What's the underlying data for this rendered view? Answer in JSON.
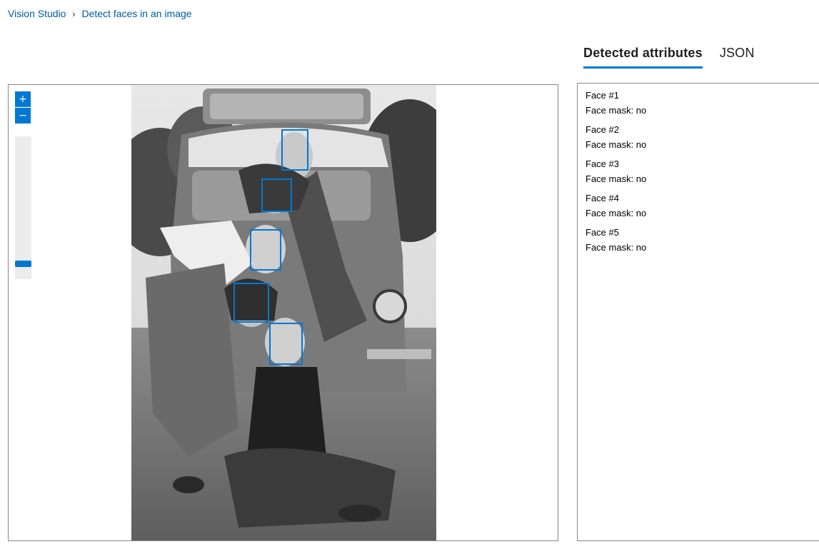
{
  "breadcrumb": {
    "root": "Vision Studio",
    "separator": "›",
    "current": "Detect faces in an image"
  },
  "viewer": {
    "zoom_in_icon": "plus-icon",
    "zoom_out_icon": "minus-icon",
    "zoom_in_label": "+",
    "zoom_out_label": "−",
    "zoom_level": 0.05
  },
  "tabs": [
    {
      "label": "Detected attributes",
      "active": true
    },
    {
      "label": "JSON",
      "active": false
    }
  ],
  "faces": [
    {
      "title": "Face #1",
      "mask": "Face mask: no"
    },
    {
      "title": "Face #2",
      "mask": "Face mask: no"
    },
    {
      "title": "Face #3",
      "mask": "Face mask: no"
    },
    {
      "title": "Face #4",
      "mask": "Face mask: no"
    },
    {
      "title": "Face #5",
      "mask": "Face mask: no"
    }
  ],
  "colors": {
    "accent": "#0078d4",
    "link": "#005a9e"
  }
}
